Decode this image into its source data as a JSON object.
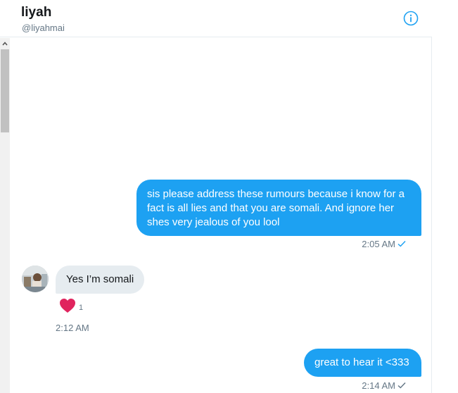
{
  "header": {
    "name": "liyah",
    "handle": "@liyahmai",
    "info_icon": "info-icon"
  },
  "colors": {
    "accent": "#1da1f2",
    "incoming_bubble": "#e6ecf0",
    "heart": "#e0245e",
    "muted_text": "#657786"
  },
  "messages": [
    {
      "direction": "outgoing",
      "text": "sis please address these rumours because i know for a fact is all lies and that you are somali. And ignore her shes very jealous of you lool",
      "time": "2:05 AM",
      "status_icon": "check-icon"
    },
    {
      "direction": "incoming",
      "text": "Yes I’m somali",
      "time": "2:12 AM",
      "reaction": {
        "icon": "heart-icon",
        "count": "1"
      }
    },
    {
      "direction": "outgoing",
      "text": "great to hear it <333",
      "time": "2:14 AM",
      "status_icon": "check-icon"
    }
  ]
}
